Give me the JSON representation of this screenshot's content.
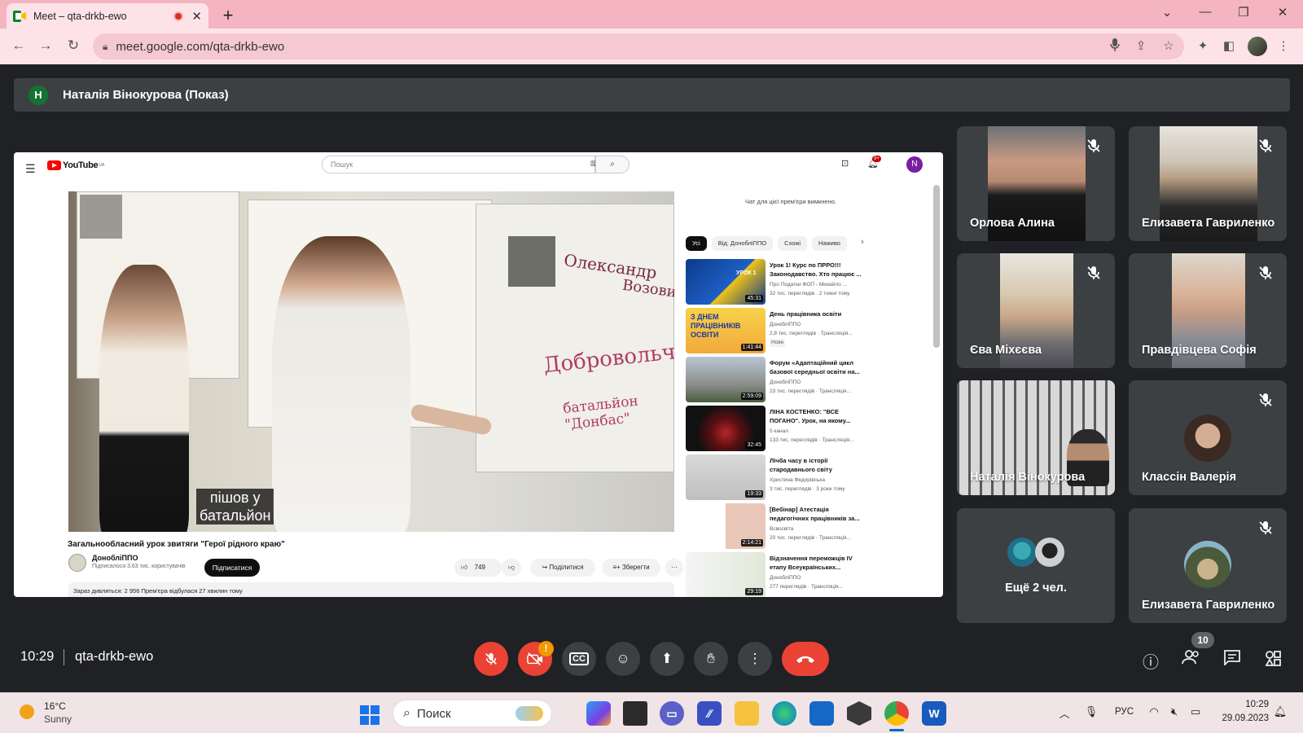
{
  "browser": {
    "tab_title": "Meet – qta-drkb-ewo",
    "url": "meet.google.com/qta-drkb-ewo"
  },
  "presenter": {
    "initial": "Н",
    "label": "Наталія Вінокурова (Показ)"
  },
  "youtube": {
    "logo": "YouTube",
    "logo_region": "UA",
    "search_placeholder": "Пошук",
    "notif_badge": "9+",
    "avatar_initial": "N",
    "caption_line1": "пішов у",
    "caption_line2": "батальйон",
    "video_title": "Загальнообласний урок звитяги \"Герої рідного краю\"",
    "channel": "ДонобліППО",
    "subscribers": "Підписалося 3,63 тис. користувачів",
    "subscribe": "Підписатися",
    "likes": "749",
    "share": "Поділитися",
    "save": "Зберегти",
    "more": "···",
    "stats": "Зараз дивляться: 2 956  Прем'єра відбулася 27 хвилин тому",
    "chat_disabled": "Чат для цієї прем'єри вимкнено.",
    "chips": [
      "Усі",
      "Від: ДонобліППО",
      "Схожі",
      "Наживо"
    ],
    "recommendations": [
      {
        "title": "Урок 1! Курс по ПРРО!!! Законодавство. Хто працює ...",
        "channel": "Про Податки ФОП - Михайло ...",
        "meta": "32 тис. переглядів · 2 тижні тому",
        "duration": "45:31"
      },
      {
        "title": "День працівника освіти",
        "channel": "ДонобліППО",
        "meta": "2,8 тис. переглядів · Трансляція...",
        "extra": "Нове",
        "duration": "1:41:44"
      },
      {
        "title": "Форум «Адаптаційний цикл базової середньої освіти на...",
        "channel": "ДонобліППО",
        "meta": "23 тис. переглядів · Трансляція...",
        "duration": "2:59:09"
      },
      {
        "title": "ЛІНА КОСТЕНКО: \"ВСЕ ПОГАНО\". Урок, на якому...",
        "channel": "5 канал",
        "meta": "133 тис. переглядів · Трансляція...",
        "duration": "32:45"
      },
      {
        "title": "Лічба часу в історії стародавнього світу",
        "channel": "Христина Федорівська",
        "meta": "3 тис. переглядів · 3 роки тому",
        "duration": "19:33"
      },
      {
        "title": "[Вебінар] Атестація педагогічних працівників за...",
        "channel": "Всвосвіта",
        "meta": "20 тис. переглядів · Трансляція...",
        "duration": "2:14:21"
      },
      {
        "title": "Відзначення переможців IV етапу Всеукраїнських...",
        "channel": "ДонобліППО",
        "meta": "277 переглядів · Трансляція...",
        "duration": "29:19"
      }
    ],
    "thumb_text_1": "УРОК 1",
    "thumb_text_2": "З ДНЕМ ПРАЦІВНИКІВ ОСВІТИ"
  },
  "participants": [
    {
      "name": "Орлова Алина",
      "muted": true
    },
    {
      "name": "Елизавета Гавриленко",
      "muted": true
    },
    {
      "name": "Єва Міхєєва",
      "muted": true
    },
    {
      "name": "Правдівцева Софія",
      "muted": true
    },
    {
      "name": "Наталія Вінокурова",
      "muted": false
    },
    {
      "name": "Классін Валерія",
      "muted": true
    },
    {
      "name": "Ещё 2 чел.",
      "muted": false
    },
    {
      "name": "Елизавета Гавриленко",
      "muted": true
    }
  ],
  "meeting": {
    "time": "10:29",
    "code": "qta-drkb-ewo",
    "participant_count": "10",
    "camera_warning": "!"
  },
  "colors": {
    "hangup": "#ea4335",
    "tile_bg": "#3c4043",
    "page_bg": "#202124",
    "tab_bar": "#f4b4c0"
  },
  "taskbar": {
    "temperature": "16°C",
    "condition": "Sunny",
    "search": "Поиск",
    "language": "РУС",
    "time": "10:29",
    "date": "29.09.2023"
  }
}
